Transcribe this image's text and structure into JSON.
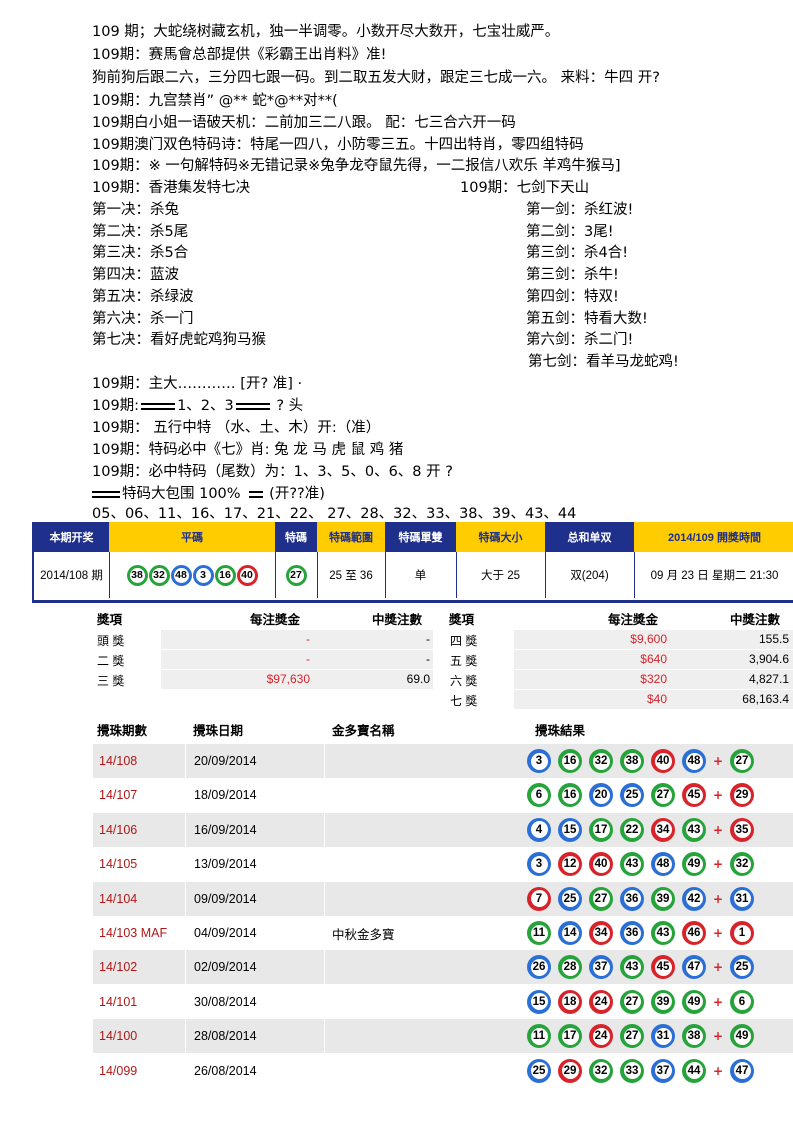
{
  "lines": [
    "109 期；大蛇绕树藏玄机，独一半调零。小数开尽大数开，七宝壮威严。",
    "109期：赛馬會总部提供《彩霸王出肖料》准!",
    "狗前狗后跟二六，三分四七跟一码。到二取五发大财，跟定三七成一六。 来料：牛四  开?",
    "109期：九宫禁肖” @** 蛇*@**对**(",
    "109期白小姐一语破天机：二前加三二八跟。 配：七三合六开一码",
    "109期澳门双色特码诗：特尾一四八，小防零三五。十四出特肖，零四组特码",
    "109期：※ 一句解特码※无错记录※兔争龙夺鼠先得，一二报信八欢乐 羊鸡牛猴马]"
  ],
  "left_block": {
    "title": "109期：香港集发特七决",
    "items": [
      "第一决：杀兔",
      "第二决：杀5尾",
      "第三决：杀5合",
      "第四决：蓝波",
      "第五决：杀绿波",
      "第六决：杀一门",
      "第七决：看好虎蛇鸡狗马猴"
    ]
  },
  "right_block": {
    "title": "109期：七剑下天山",
    "items": [
      "第一剑：杀红波!",
      "第二剑：3尾!",
      "第三剑：杀4合!",
      "第三剑：杀牛!",
      "第四剑：特双!",
      "第五剑：特看大数!",
      "第六剑：杀二门!",
      "第七剑：看羊马龙蛇鸡!"
    ]
  },
  "lines2": {
    "l1": "109期：主大………… [开? 准] ·",
    "l2a": "109期:",
    "l2b": "1、2、3",
    "l2c": " ? 头",
    "l3": "109期： 五行中特  （水、土、木）开:（准）",
    "l4": "109期：特码必中《七》肖: 兔 龙 马 虎 鼠 鸡  猪",
    "l5": "109期：必中特码（尾数）为：1、3、5、0、6、8      开 ?",
    "l6a": "特码大包围 100%",
    "l6b": "  (开??准)",
    "l7": "05、06、11、16、17、21、22、 27、28、32、33、38、39、43、44"
  },
  "summary": {
    "headers": [
      "本期开奖",
      "平碼",
      "特碼",
      "特碼範圍",
      "特碼單雙",
      "特碼大小",
      "总和单双",
      "2014/109 開獎時間"
    ],
    "period": "2014/108 期",
    "balls": [
      {
        "n": "38",
        "c": "green"
      },
      {
        "n": "32",
        "c": "green"
      },
      {
        "n": "48",
        "c": "blue"
      },
      {
        "n": "3",
        "c": "blue"
      },
      {
        "n": "16",
        "c": "green"
      },
      {
        "n": "40",
        "c": "red"
      }
    ],
    "special": {
      "n": "27",
      "c": "green"
    },
    "range": "25 至 36",
    "odd_even": "单",
    "size": "大于 25",
    "total_odd_even": "双(204)",
    "next_draw": "09 月 23 日  星期二  21:30"
  },
  "prizes": {
    "headers": [
      "獎項",
      "每注獎金",
      "中獎注數"
    ],
    "left": [
      {
        "name": "頭 獎",
        "amount": "-",
        "count": "-"
      },
      {
        "name": "二 獎",
        "amount": "-",
        "count": "-"
      },
      {
        "name": "三 獎",
        "amount": "$97,630",
        "count": "69.0"
      }
    ],
    "right": [
      {
        "name": "四 獎",
        "amount": "$9,600",
        "count": "155.5"
      },
      {
        "name": "五 獎",
        "amount": "$640",
        "count": "3,904.6"
      },
      {
        "name": "六 獎",
        "amount": "$320",
        "count": "4,827.1"
      },
      {
        "name": "七 獎",
        "amount": "$40",
        "count": "68,163.4"
      }
    ]
  },
  "results": {
    "headers": [
      "攪珠期數",
      "攪珠日期",
      "金多寶名稱",
      "攪珠結果"
    ],
    "rows": [
      {
        "id": "14/108",
        "date": "20/09/2014",
        "name": "",
        "balls": [
          [
            "3",
            "blue"
          ],
          [
            "16",
            "green"
          ],
          [
            "32",
            "green"
          ],
          [
            "38",
            "green"
          ],
          [
            "40",
            "red"
          ],
          [
            "48",
            "blue"
          ]
        ],
        "sp": [
          "27",
          "green"
        ]
      },
      {
        "id": "14/107",
        "date": "18/09/2014",
        "name": "",
        "balls": [
          [
            "6",
            "green"
          ],
          [
            "16",
            "green"
          ],
          [
            "20",
            "blue"
          ],
          [
            "25",
            "blue"
          ],
          [
            "27",
            "green"
          ],
          [
            "45",
            "red"
          ]
        ],
        "sp": [
          "29",
          "red"
        ]
      },
      {
        "id": "14/106",
        "date": "16/09/2014",
        "name": "",
        "balls": [
          [
            "4",
            "blue"
          ],
          [
            "15",
            "blue"
          ],
          [
            "17",
            "green"
          ],
          [
            "22",
            "green"
          ],
          [
            "34",
            "red"
          ],
          [
            "43",
            "green"
          ]
        ],
        "sp": [
          "35",
          "red"
        ]
      },
      {
        "id": "14/105",
        "date": "13/09/2014",
        "name": "",
        "balls": [
          [
            "3",
            "blue"
          ],
          [
            "12",
            "red"
          ],
          [
            "40",
            "red"
          ],
          [
            "43",
            "green"
          ],
          [
            "48",
            "blue"
          ],
          [
            "49",
            "green"
          ]
        ],
        "sp": [
          "32",
          "green"
        ]
      },
      {
        "id": "14/104",
        "date": "09/09/2014",
        "name": "",
        "balls": [
          [
            "7",
            "red"
          ],
          [
            "25",
            "blue"
          ],
          [
            "27",
            "green"
          ],
          [
            "36",
            "blue"
          ],
          [
            "39",
            "green"
          ],
          [
            "42",
            "blue"
          ]
        ],
        "sp": [
          "31",
          "blue"
        ]
      },
      {
        "id": "14/103 MAF",
        "date": "04/09/2014",
        "name": "中秋金多寶",
        "balls": [
          [
            "11",
            "green"
          ],
          [
            "14",
            "blue"
          ],
          [
            "34",
            "red"
          ],
          [
            "36",
            "blue"
          ],
          [
            "43",
            "green"
          ],
          [
            "46",
            "red"
          ]
        ],
        "sp": [
          "1",
          "red"
        ]
      },
      {
        "id": "14/102",
        "date": "02/09/2014",
        "name": "",
        "balls": [
          [
            "26",
            "blue"
          ],
          [
            "28",
            "green"
          ],
          [
            "37",
            "blue"
          ],
          [
            "43",
            "green"
          ],
          [
            "45",
            "red"
          ],
          [
            "47",
            "blue"
          ]
        ],
        "sp": [
          "25",
          "blue"
        ]
      },
      {
        "id": "14/101",
        "date": "30/08/2014",
        "name": "",
        "balls": [
          [
            "15",
            "blue"
          ],
          [
            "18",
            "red"
          ],
          [
            "24",
            "red"
          ],
          [
            "27",
            "green"
          ],
          [
            "39",
            "green"
          ],
          [
            "49",
            "green"
          ]
        ],
        "sp": [
          "6",
          "green"
        ]
      },
      {
        "id": "14/100",
        "date": "28/08/2014",
        "name": "",
        "balls": [
          [
            "11",
            "green"
          ],
          [
            "17",
            "green"
          ],
          [
            "24",
            "red"
          ],
          [
            "27",
            "green"
          ],
          [
            "31",
            "blue"
          ],
          [
            "38",
            "green"
          ]
        ],
        "sp": [
          "49",
          "green"
        ]
      },
      {
        "id": "14/099",
        "date": "26/08/2014",
        "name": "",
        "balls": [
          [
            "25",
            "blue"
          ],
          [
            "29",
            "red"
          ],
          [
            "32",
            "green"
          ],
          [
            "33",
            "green"
          ],
          [
            "37",
            "blue"
          ],
          [
            "44",
            "green"
          ]
        ],
        "sp": [
          "47",
          "blue"
        ]
      }
    ]
  }
}
